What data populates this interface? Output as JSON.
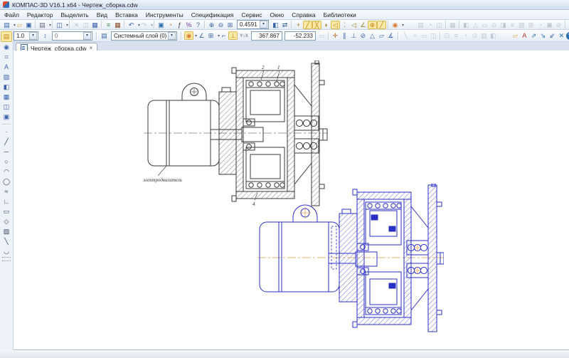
{
  "window": {
    "title": "КОМПАС-3D V16.1 x64 - Чертеж_сборка.cdw"
  },
  "menu": {
    "items": [
      "Файл",
      "Редактор",
      "Выделить",
      "Вид",
      "Вставка",
      "Инструменты",
      "Спецификация",
      "Сервис",
      "Окно",
      "Справка",
      "Библиотеки"
    ]
  },
  "toolbar1": {
    "zoom_value": "0.4591",
    "left_icons": [
      {
        "name": "new-document-icon",
        "g": "▤",
        "c": "#3a62a8",
        "cls": "dd"
      },
      {
        "name": "open-document-icon",
        "g": "▱",
        "c": "#d9a62e"
      },
      {
        "name": "save-icon",
        "g": "▣",
        "c": "#3a62a8"
      },
      "|",
      {
        "name": "print-icon",
        "g": "▤",
        "c": "#667",
        "cls": "dd"
      },
      "|",
      {
        "name": "print-preview-icon",
        "g": "◫",
        "c": "#3a62a8",
        "cls": "dd"
      },
      "|",
      {
        "name": "cut-icon",
        "g": "✕",
        "cls": "dis"
      },
      {
        "name": "copy-icon",
        "g": "◫",
        "cls": "dis"
      },
      {
        "name": "paste-icon",
        "g": "▦",
        "c": "#3a62a8"
      },
      "|",
      {
        "name": "copy-properties-icon",
        "g": "≡",
        "c": "#3f8f3f"
      },
      {
        "name": "insert-table-icon",
        "g": "▦",
        "c": "#8a4a2a"
      },
      "|",
      {
        "name": "undo-icon",
        "g": "↶",
        "c": "#3a62a8",
        "cls": "dd"
      },
      {
        "name": "redo-icon",
        "g": "↷",
        "cls": "dis dd"
      },
      "|",
      {
        "name": "document-manager-icon",
        "g": "▣",
        "c": "#2e6fb0"
      },
      {
        "name": "rebuild-icon",
        "g": "◔",
        "c": "#d97b2e"
      },
      {
        "name": "fx-icon",
        "g": "ƒ",
        "c": "#333"
      },
      {
        "name": "variables-icon",
        "g": "%",
        "c": "#7a3fa0"
      },
      {
        "name": "context-help-icon",
        "g": "?",
        "c": "#3a62a8"
      },
      "|",
      {
        "name": "zoom-in-icon",
        "g": "⊕",
        "c": "#3a62a8"
      },
      {
        "name": "zoom-out-icon",
        "g": "⊖",
        "c": "#3a62a8"
      },
      {
        "name": "zoom-area-icon",
        "g": "⊞",
        "c": "#3a62a8"
      }
    ],
    "mid_icons": [
      {
        "name": "fit-document-icon",
        "g": "◧",
        "c": "#3a62a8"
      },
      {
        "name": "previous-view-icon",
        "g": "⇄",
        "c": "#3a62a8"
      },
      "|",
      {
        "name": "snap-point-icon",
        "g": "+",
        "c": "#9a7b1e"
      },
      {
        "name": "snap-line-icon",
        "g": "╱",
        "c": "#b8860b",
        "cls": "hl"
      },
      {
        "name": "snap-cross-icon",
        "g": "╳",
        "c": "#b8860b",
        "cls": "hl"
      },
      {
        "name": "snap-arc-icon",
        "g": "◗",
        "c": "#9a7b1e"
      },
      {
        "name": "snap-angle-icon",
        "g": "◁",
        "c": "#b8860b",
        "cls": "hl"
      },
      {
        "name": "snap-grid-icon",
        "g": "⁚",
        "c": "#9a7b1e"
      },
      {
        "name": "snap-tangent-icon",
        "g": "◁",
        "c": "#9a7b1e"
      },
      {
        "name": "snap-normal-icon",
        "g": "∠",
        "c": "#9a7b1e"
      },
      {
        "name": "snap-center-icon",
        "g": "⊕",
        "c": "#b8860b",
        "cls": "hl"
      },
      {
        "name": "snap-pencil-icon",
        "g": "╱",
        "c": "#b8860b",
        "cls": "hl"
      },
      "|",
      {
        "name": "snaps-magnet-icon",
        "g": "◉",
        "c": "#d97b2e",
        "cls": "dd"
      }
    ],
    "right_icons": [
      {
        "name": "inactive-tool-icon-1",
        "g": "▤",
        "cls": "dis"
      },
      {
        "name": "inactive-tool-icon-2",
        "g": "◔",
        "cls": "dis"
      },
      {
        "name": "inactive-tool-icon-3",
        "g": "◫",
        "cls": "dis"
      },
      "|",
      {
        "name": "inactive-tool-icon-4",
        "g": "▦",
        "cls": "dis"
      },
      "|",
      {
        "name": "inactive-tool-icon-5",
        "g": "◧",
        "cls": "dis"
      },
      {
        "name": "inactive-tool-icon-6",
        "g": "△",
        "cls": "dis"
      },
      {
        "name": "inactive-tool-icon-7",
        "g": "▭",
        "cls": "dis"
      },
      {
        "name": "inactive-tool-icon-8",
        "g": "⊙",
        "cls": "dis"
      },
      {
        "name": "inactive-tool-icon-9",
        "g": "◨",
        "cls": "dis"
      },
      {
        "name": "inactive-tool-icon-10",
        "g": "≡",
        "cls": "dis"
      },
      {
        "name": "inactive-tool-icon-11",
        "g": "▥",
        "cls": "dis"
      },
      {
        "name": "inactive-tool-icon-12",
        "g": "⊞",
        "cls": "dis"
      },
      {
        "name": "inactive-tool-icon-13",
        "g": "◔",
        "cls": "dis"
      },
      {
        "name": "inactive-tool-icon-14",
        "g": "▣",
        "cls": "dis"
      },
      {
        "name": "inactive-tool-icon-15",
        "g": "⊘",
        "cls": "dis"
      },
      "|",
      {
        "name": "inactive-tool-icon-16",
        "g": "◬",
        "cls": "dis"
      },
      {
        "name": "inactive-tool-icon-17",
        "g": "◪",
        "cls": "dis"
      }
    ]
  },
  "toolbar2": {
    "line_scale": "1.0",
    "string_value": "0",
    "layer": "Системный слой (0)",
    "coord_label": "Y↕X",
    "x_coord": "367.867",
    "y_coord": "-52.233",
    "g1": [
      {
        "name": "document-scale-icon",
        "g": "⇄",
        "c": "#3a62a8"
      }
    ],
    "g2": [
      {
        "name": "string-style-icon",
        "g": "↕",
        "c": "#3a62a8"
      }
    ],
    "g3": [
      {
        "name": "layers-icon",
        "g": "▤",
        "c": "#3a62a8"
      }
    ],
    "g4": [
      {
        "name": "magnet-snaps-icon",
        "g": "◉",
        "c": "#d97b2e",
        "cls": "hl dd"
      },
      {
        "name": "angle-snap-icon",
        "g": "∠",
        "c": "#3a62a8"
      },
      {
        "name": "grid-icon",
        "g": "⊞",
        "c": "#3a62a8",
        "cls": "dd"
      },
      {
        "name": "local-cs-icon",
        "g": "⌐",
        "c": "#3a62a8"
      },
      {
        "name": "ortho-drawing-icon",
        "g": "⊥",
        "c": "#b8860b",
        "cls": "hl"
      }
    ],
    "g5": [
      {
        "name": "assoc-view-icon",
        "g": "▭",
        "cls": "dis"
      },
      "|",
      {
        "name": "align-points-icon",
        "g": "✛",
        "c": "#b06820"
      },
      {
        "name": "parallel-constraint-icon",
        "g": "∥",
        "c": "#3a62a8"
      },
      {
        "name": "perpendicular-constraint-icon",
        "g": "⊥",
        "c": "#3a62a8"
      },
      {
        "name": "tangent-constraint-icon",
        "g": "⊘",
        "c": "#3a62a8"
      },
      {
        "name": "triangle-constraint-icon",
        "g": "△",
        "c": "#3a62a8"
      },
      {
        "name": "collinear-constraint-icon",
        "g": "▱",
        "c": "#3a62a8"
      },
      {
        "name": "angle-dimension-icon",
        "g": "∡",
        "c": "#3a62a8"
      }
    ],
    "g6": [
      {
        "name": "inactive-param-icon-1",
        "g": "╲",
        "cls": "dis"
      },
      {
        "name": "inactive-param-icon-2",
        "g": "≈",
        "cls": "dis"
      },
      {
        "name": "inactive-param-icon-3",
        "g": "▭",
        "cls": "dis"
      },
      {
        "name": "inactive-param-icon-4",
        "g": "◫",
        "cls": "dis"
      },
      "|",
      {
        "name": "inactive-param-icon-5",
        "g": "⊡",
        "cls": "dis"
      },
      {
        "name": "inactive-param-icon-6",
        "g": "≡",
        "cls": "dis"
      },
      {
        "name": "inactive-param-icon-7",
        "g": "◔",
        "cls": "dis"
      },
      {
        "name": "inactive-param-icon-8",
        "g": "⊙",
        "cls": "dis"
      },
      {
        "name": "inactive-param-icon-9",
        "g": "▥",
        "cls": "dis"
      },
      {
        "name": "inactive-param-icon-10",
        "g": "◧",
        "cls": "dis"
      }
    ],
    "g7": [
      {
        "name": "library-manager-icon",
        "g": "▱",
        "c": "#d9a62e"
      },
      {
        "name": "library-a-icon",
        "g": "A",
        "c": "#c03b2e"
      },
      {
        "name": "library-tool-icon-1",
        "g": "⇗",
        "c": "#2e6fb0"
      },
      {
        "name": "library-tool-icon-2",
        "g": "⇘",
        "c": "#2e6fb0"
      },
      {
        "name": "library-tool-icon-3",
        "g": "⇙",
        "c": "#1e4f90"
      },
      {
        "name": "library-close-icon",
        "g": "✕",
        "c": "#2e6fb0"
      },
      {
        "name": "library-help-icon",
        "g": "?",
        "c": "#fff",
        "bg": "#2e6fb0",
        "cls": "rnd"
      }
    ]
  },
  "tabs": {
    "active_label": "Чертеж_сборка.cdw",
    "close_glyph": "×"
  },
  "leftbar": {
    "icons": [
      {
        "name": "compact-panel-icon",
        "g": "▤",
        "c": "#b8860b",
        "cls": "hl"
      },
      {
        "name": "geometry-panel-icon",
        "g": "◉",
        "c": "#3a62a8"
      },
      {
        "name": "dimensions-panel-icon",
        "g": "⌗",
        "c": "#3a62a8"
      },
      {
        "name": "designations-panel-icon",
        "g": "A",
        "c": "#3a62a8"
      },
      {
        "name": "editing-panel-icon",
        "g": "▨",
        "c": "#3a62a8"
      },
      {
        "name": "parametrization-panel-icon",
        "g": "◧",
        "c": "#3a62a8"
      },
      {
        "name": "measure-panel-icon",
        "g": "▦",
        "c": "#3a62a8"
      },
      {
        "name": "selection-panel-icon",
        "g": "◫",
        "c": "#3a62a8"
      },
      {
        "name": "spec-panel-icon",
        "g": "▣",
        "c": "#3a62a8"
      },
      "|",
      {
        "name": "point-tool-icon",
        "g": "·",
        "c": "#334466"
      },
      {
        "name": "aux-line-tool-icon",
        "g": "╱",
        "c": "#334466"
      },
      {
        "name": "line-tool-icon",
        "g": "─",
        "c": "#334466"
      },
      {
        "name": "circle-tool-icon",
        "g": "○",
        "c": "#334466"
      },
      {
        "name": "arc-tool-icon",
        "g": "◠",
        "c": "#334466"
      },
      {
        "name": "ellipse-tool-icon",
        "g": "◯",
        "c": "#334466"
      },
      {
        "name": "curve-tool-icon",
        "g": "≈",
        "c": "#334466"
      },
      {
        "name": "polyline-tool-icon",
        "g": "∟",
        "c": "#334466"
      },
      {
        "name": "rectangle-tool-icon",
        "g": "▭",
        "c": "#334466"
      },
      {
        "name": "polygon-tool-icon",
        "g": "◇",
        "c": "#334466"
      },
      {
        "name": "hatch-tool-icon",
        "g": "▨",
        "c": "#334466"
      },
      {
        "name": "chamfer-tool-icon",
        "g": "╲",
        "c": "#334466"
      },
      {
        "name": "fillet-tool-icon",
        "g": "◡",
        "c": "#334466"
      }
    ]
  },
  "drawings": {
    "raster": {
      "motor_label": "электродвигатель",
      "callout_top_left": "2",
      "callout_top_right": "1",
      "callout_bottom": "4"
    },
    "colors": {
      "raster_ink": "#3a3a3a",
      "cad_ink": "#2a2fc4",
      "centerline_orange": "#e09a3e"
    }
  }
}
